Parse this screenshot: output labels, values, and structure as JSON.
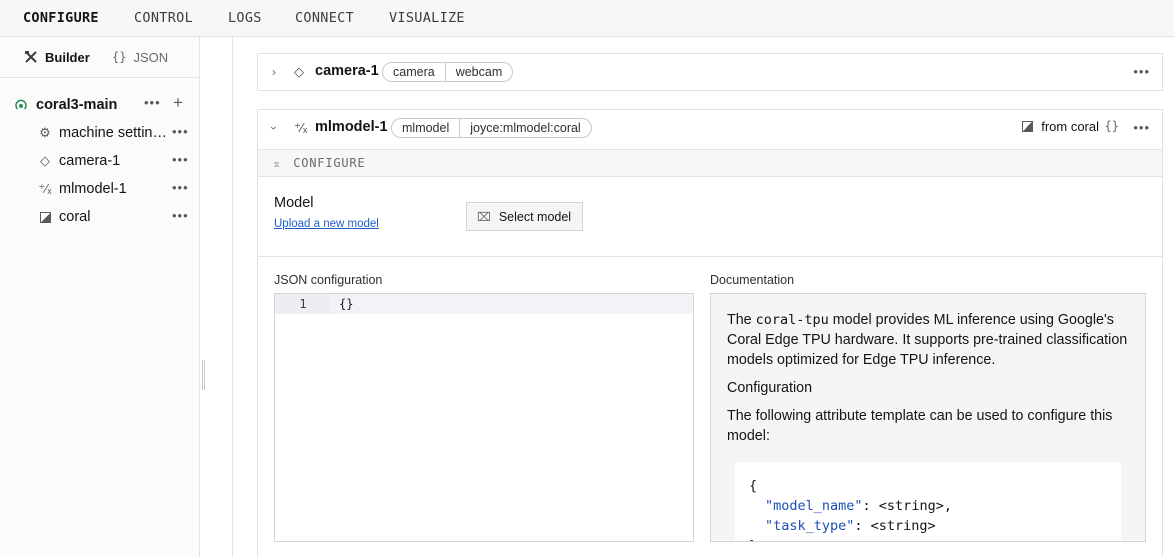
{
  "nav": {
    "tabs": [
      "CONFIGURE",
      "CONTROL",
      "LOGS",
      "CONNECT",
      "VISUALIZE"
    ],
    "active": "CONFIGURE"
  },
  "sidebar": {
    "modes": {
      "builder": "Builder",
      "json": "JSON"
    },
    "robot": "coral3-main",
    "items": [
      {
        "label": "machine settings",
        "icon": "gear-icon"
      },
      {
        "label": "camera-1",
        "icon": "diamond-icon"
      },
      {
        "label": "mlmodel-1",
        "icon": "mlmodel-icon"
      },
      {
        "label": "coral",
        "icon": "module-icon"
      }
    ]
  },
  "cards": {
    "camera": {
      "name": "camera-1",
      "api": "camera",
      "model": "webcam"
    },
    "mlmodel": {
      "name": "mlmodel-1",
      "api": "mlmodel",
      "model": "joyce:mlmodel:coral",
      "dependency": "from coral",
      "section": "CONFIGURE",
      "model_label": "Model",
      "upload_link": "Upload a new model",
      "select_button": "Select model",
      "json_label": "JSON configuration",
      "json_line_number": "1",
      "json_value": "{}",
      "doc_label": "Documentation",
      "doc": {
        "intro_pre": "The ",
        "intro_code": "coral-tpu",
        "intro_post": " model provides ML inference using Google's Coral Edge TPU hardware. It supports pre-trained classification models optimized for Edge TPU inference.",
        "heading": "Configuration",
        "template_text": "The following attribute template can be used to configure this model:",
        "code_open": "{",
        "code_key1": "\"model_name\"",
        "code_val1": ": <string>,",
        "code_key2": "\"task_type\"",
        "code_val2": ": <string>",
        "code_close": "}"
      }
    }
  },
  "colors": {
    "accent": "#1f5ec6",
    "online": "#2e8b57"
  }
}
